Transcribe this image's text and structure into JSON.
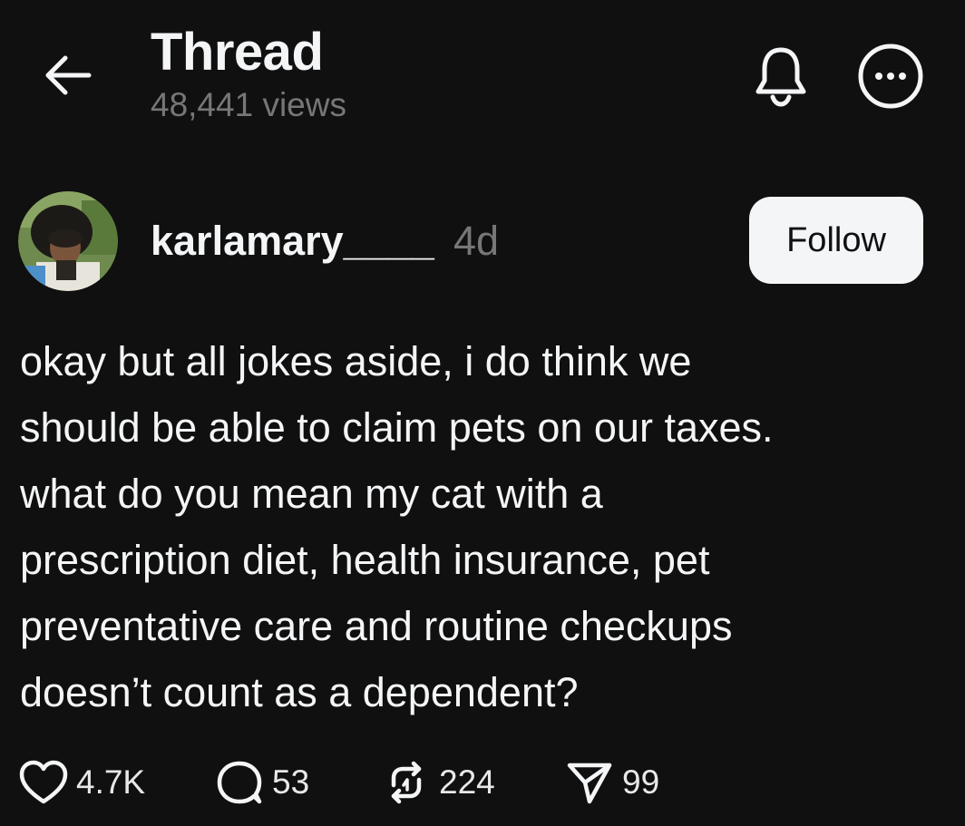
{
  "header": {
    "back_icon": "arrow-left-icon",
    "title": "Thread",
    "views": "48,441 views",
    "bell_icon": "bell-icon",
    "more_icon": "more-circle-icon"
  },
  "post": {
    "author": {
      "avatar_icon": "avatar-photo",
      "username": "karlamary____",
      "timestamp": "4d"
    },
    "follow_label": "Follow",
    "lines": [
      "okay but all jokes aside, i do think we",
      "should be able to claim pets on our taxes.",
      "what do you mean my cat with a",
      "prescription diet, health insurance, pet",
      "preventative care and routine checkups",
      "doesn’t count as a dependent?"
    ],
    "actions": {
      "likes": "4.7K",
      "replies": "53",
      "reposts": "224",
      "shares": "99"
    }
  },
  "colors": {
    "background": "#101010",
    "text_primary": "#f3f5f7",
    "text_secondary": "#777777",
    "button_bg": "#f3f5f7"
  }
}
